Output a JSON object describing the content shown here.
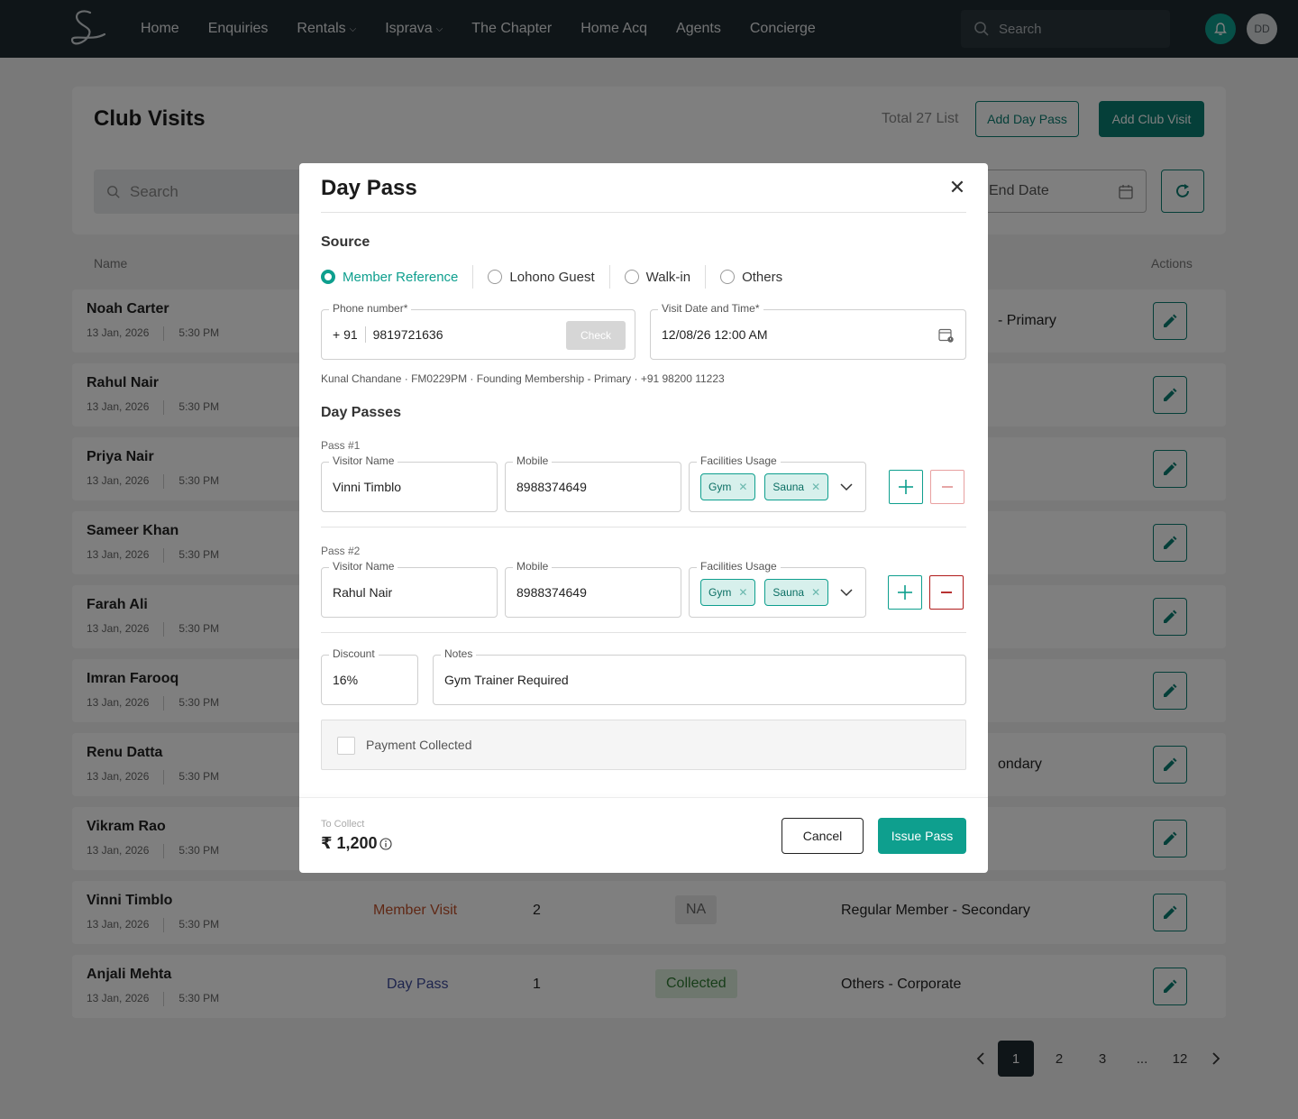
{
  "nav": {
    "items": [
      {
        "label": "Home",
        "dropdown": false
      },
      {
        "label": "Enquiries",
        "dropdown": false
      },
      {
        "label": "Rentals",
        "dropdown": true
      },
      {
        "label": "Isprava",
        "dropdown": true
      },
      {
        "label": "The Chapter",
        "dropdown": false
      },
      {
        "label": "Home Acq",
        "dropdown": false
      },
      {
        "label": "Agents",
        "dropdown": false
      },
      {
        "label": "Concierge",
        "dropdown": false
      }
    ],
    "search_placeholder": "Search",
    "avatar_initials": "DD",
    "bell_icon": "bell-icon"
  },
  "page": {
    "title": "Club Visits",
    "total": "Total 27 List",
    "add_day_pass": "Add Day Pass",
    "add_club_visit": "Add Club Visit",
    "search_placeholder": "Search",
    "end_date_placeholder": "End Date",
    "columns": {
      "name": "Name",
      "actions": "Actions"
    }
  },
  "rows": [
    {
      "name": "Noah Carter",
      "date": "13 Jan, 2026",
      "time": "5:30 PM",
      "membership": "- Primary"
    },
    {
      "name": "Rahul Nair",
      "date": "13 Jan, 2026",
      "time": "5:30 PM"
    },
    {
      "name": "Priya Nair",
      "date": "13 Jan, 2026",
      "time": "5:30 PM"
    },
    {
      "name": "Sameer Khan",
      "date": "13 Jan, 2026",
      "time": "5:30 PM"
    },
    {
      "name": "Farah Ali",
      "date": "13 Jan, 2026",
      "time": "5:30 PM"
    },
    {
      "name": "Imran Farooq",
      "date": "13 Jan, 2026",
      "time": "5:30 PM"
    },
    {
      "name": "Renu Datta",
      "date": "13 Jan, 2026",
      "time": "5:30 PM",
      "membership": "ondary"
    },
    {
      "name": "Vikram Rao",
      "date": "13 Jan, 2026",
      "time": "5:30 PM"
    },
    {
      "name": "Vinni Timblo",
      "date": "13 Jan, 2026",
      "time": "5:30 PM",
      "type": "Member Visit",
      "count": "2",
      "payment": "NA",
      "membership": "Regular Member - Secondary"
    },
    {
      "name": "Anjali Mehta",
      "date": "13 Jan, 2026",
      "time": "5:30 PM",
      "type": "Day Pass",
      "count": "1",
      "payment": "Collected",
      "membership": "Others - Corporate"
    }
  ],
  "pagination": {
    "pages": [
      "1",
      "2",
      "3",
      "...",
      "12"
    ],
    "current": "1"
  },
  "colors": {
    "accent": "#0e9f8e",
    "accent_dark": "#0b7e72",
    "nav_bg": "#1f2a30",
    "member_visit": "#c0502a",
    "day_pass": "#3d4a9a",
    "collected_bg": "#dcefdc",
    "collected_fg": "#2f7a32"
  },
  "modal": {
    "title": "Day Pass",
    "source_label": "Source",
    "sources": [
      {
        "label": "Member Reference",
        "selected": true
      },
      {
        "label": "Lohono Guest",
        "selected": false
      },
      {
        "label": "Walk-in",
        "selected": false
      },
      {
        "label": "Others",
        "selected": false
      }
    ],
    "phone_label": "Phone number*",
    "phone_code": "+ 91",
    "phone_value": "9819721636",
    "check_label": "Check",
    "visit_label": "Visit Date and Time*",
    "visit_value": "12/08/26  12:00 AM",
    "member_info": "Kunal Chandane ·  FM0229PM · Founding Membership - Primary · +91 98200 11223",
    "day_passes_label": "Day Passes",
    "passes": [
      {
        "label": "Pass #1",
        "visitor_label": "Visitor Name",
        "visitor": "Vinni Timblo",
        "mobile_label": "Mobile",
        "mobile": "8988374649",
        "facilities_label": "Facilities Usage",
        "facilities": [
          "Gym",
          "Sauna"
        ]
      },
      {
        "label": "Pass #2",
        "visitor_label": "Visitor Name",
        "visitor": "Rahul Nair",
        "mobile_label": "Mobile",
        "mobile": "8988374649",
        "facilities_label": "Facilities Usage",
        "facilities": [
          "Gym",
          "Sauna"
        ]
      }
    ],
    "discount_label": "Discount",
    "discount": "16%",
    "notes_label": "Notes",
    "notes": "Gym Trainer Required",
    "payment_collected": "Payment Collected",
    "payment_checked": false,
    "to_collect_label": "To Collect",
    "to_collect": "₹ 1,200",
    "cancel": "Cancel",
    "issue": "Issue Pass"
  }
}
